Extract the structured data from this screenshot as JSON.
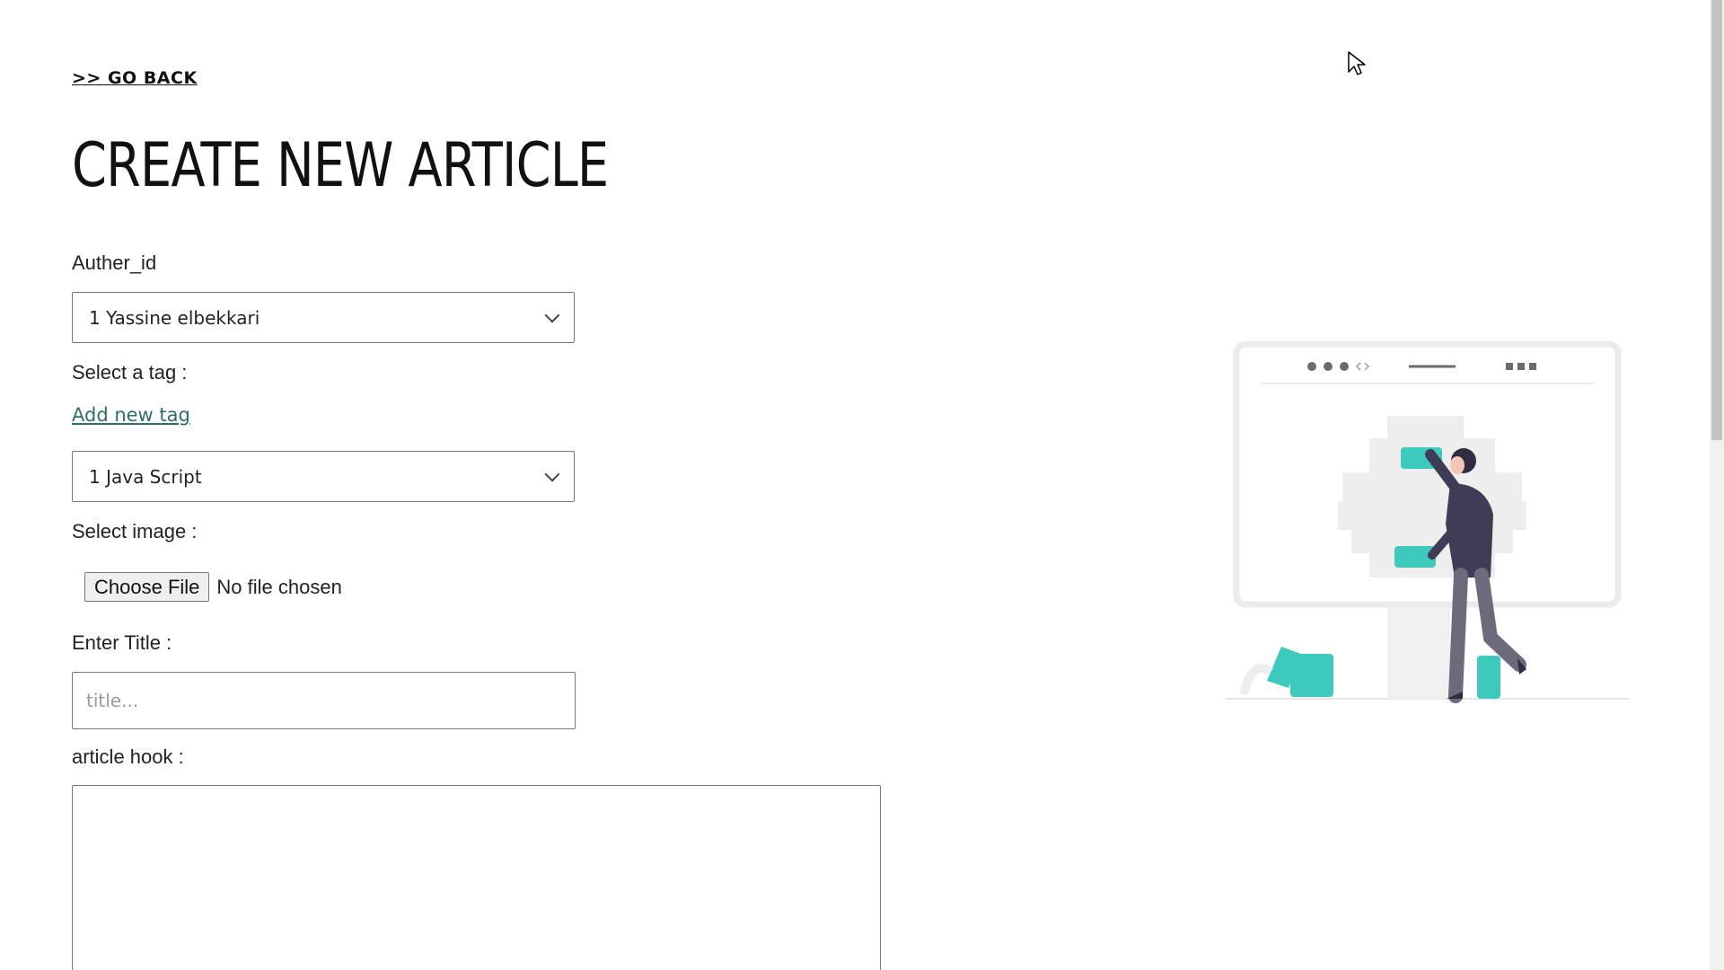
{
  "nav": {
    "go_back": ">> GO BACK"
  },
  "page": {
    "title": "CREATE NEW ARTICLE"
  },
  "form": {
    "author": {
      "label": "Auther_id",
      "selected": "1 Yassine elbekkari"
    },
    "tag": {
      "label": "Select a tag :",
      "add_link": "Add new tag",
      "selected": "1 Java Script"
    },
    "image": {
      "label": "Select image :",
      "button": "Choose File",
      "status": "No file chosen"
    },
    "title": {
      "label": "Enter Title :",
      "placeholder": "title..."
    },
    "hook": {
      "label": "article hook :",
      "value": ""
    }
  },
  "colors": {
    "accent": "#3ec9bd",
    "link": "#2f6f6a",
    "illustration_gray": "#f0f0f0"
  },
  "icons": {
    "select_arrow": "chevron-down-icon",
    "cursor": "mouse-pointer-icon"
  }
}
